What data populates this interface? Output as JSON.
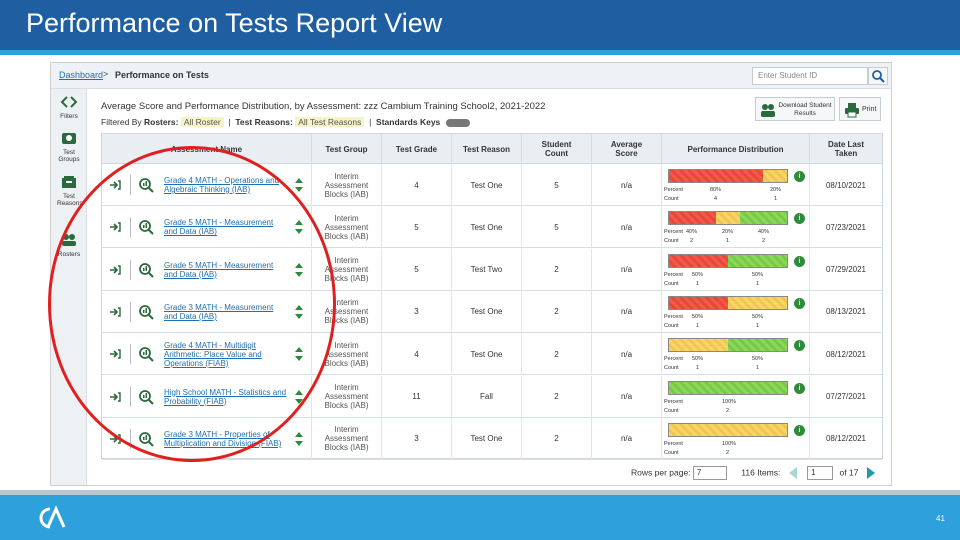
{
  "slide": {
    "title": "Performance on Tests Report View",
    "number": "41"
  },
  "nav": {
    "breadcrumb_link": "Dashboard",
    "breadcrumb_sep": ">",
    "breadcrumb_current": "Performance on Tests",
    "search_placeholder": "Enter Student ID"
  },
  "sidebar": [
    {
      "label": "Filters",
      "icon": "filters-icon"
    },
    {
      "label": "Test Groups",
      "icon": "test-groups-icon"
    },
    {
      "label": "Test Reasons",
      "icon": "test-reasons-icon"
    },
    {
      "label": "Rosters",
      "icon": "rosters-icon"
    }
  ],
  "report": {
    "title": "Average Score and Performance Distribution, by Assessment: zzz Cambium Training School2, 2021-2022",
    "filtered_by": "Filtered By",
    "rosters_label": "Rosters:",
    "rosters_value": "All Roster",
    "reasons_label": "Test Reasons:",
    "reasons_value": "All Test Reasons",
    "standards_label": "Standards Keys",
    "download_label": "Download Student Results",
    "print_label": "Print"
  },
  "columns": [
    "Assessment Name",
    "Test Group",
    "Test Grade",
    "Test Reason",
    "Student Count",
    "Average Score",
    "Performance Distribution",
    "Date Last Taken"
  ],
  "rows": [
    {
      "name": "Grade 4 MATH - Operations and Algebraic Thinking (IAB)",
      "group": "Interim Assessment Blocks (IAB)",
      "grade": "4",
      "reason": "Test One",
      "count": "5",
      "avg": "n/a",
      "date": "08/10/2021",
      "segments": [
        {
          "color": "red",
          "pct": 80
        },
        {
          "color": "yellow",
          "pct": 20
        }
      ],
      "labels": [
        {
          "pct": "80%",
          "n": "4"
        },
        {
          "pct": "20%",
          "n": "1"
        }
      ]
    },
    {
      "name": "Grade 5 MATH - Measurement and Data (IAB)",
      "group": "Interim Assessment Blocks (IAB)",
      "grade": "5",
      "reason": "Test One",
      "count": "5",
      "avg": "n/a",
      "date": "07/23/2021",
      "segments": [
        {
          "color": "red",
          "pct": 40
        },
        {
          "color": "yellow",
          "pct": 20
        },
        {
          "color": "green",
          "pct": 40
        }
      ],
      "labels": [
        {
          "pct": "40%",
          "n": "2"
        },
        {
          "pct": "20%",
          "n": "1"
        },
        {
          "pct": "40%",
          "n": "2"
        }
      ]
    },
    {
      "name": "Grade 5 MATH - Measurement and Data (IAB)",
      "group": "Interim Assessment Blocks (IAB)",
      "grade": "5",
      "reason": "Test Two",
      "count": "2",
      "avg": "n/a",
      "date": "07/29/2021",
      "segments": [
        {
          "color": "red",
          "pct": 50
        },
        {
          "color": "green",
          "pct": 50
        }
      ],
      "labels": [
        {
          "pct": "50%",
          "n": "1"
        },
        {
          "pct": "50%",
          "n": "1"
        }
      ]
    },
    {
      "name": "Grade 3 MATH - Measurement and Data (IAB)",
      "group": "Interim Assessment Blocks (IAB)",
      "grade": "3",
      "reason": "Test One",
      "count": "2",
      "avg": "n/a",
      "date": "08/13/2021",
      "segments": [
        {
          "color": "red",
          "pct": 50
        },
        {
          "color": "yellow",
          "pct": 50
        }
      ],
      "labels": [
        {
          "pct": "50%",
          "n": "1"
        },
        {
          "pct": "50%",
          "n": "1"
        }
      ]
    },
    {
      "name": "Grade 4 MATH - Multidigit Arithmetic: Place Value and Operations (FIAB)",
      "group": "Interim Assessment Blocks (IAB)",
      "grade": "4",
      "reason": "Test One",
      "count": "2",
      "avg": "n/a",
      "date": "08/12/2021",
      "segments": [
        {
          "color": "yellow",
          "pct": 50
        },
        {
          "color": "green",
          "pct": 50
        }
      ],
      "labels": [
        {
          "pct": "50%",
          "n": "1"
        },
        {
          "pct": "50%",
          "n": "1"
        }
      ]
    },
    {
      "name": "High School MATH - Statistics and Probability (FIAB)",
      "group": "Interim Assessment Blocks (IAB)",
      "grade": "11",
      "reason": "Fall",
      "count": "2",
      "avg": "n/a",
      "date": "07/27/2021",
      "segments": [
        {
          "color": "green",
          "pct": 100
        }
      ],
      "labels": [
        {
          "pct": "100%",
          "n": "2"
        }
      ]
    },
    {
      "name": "Grade 3 MATH - Properties of Multiplication and Division (FIAB)",
      "group": "Interim Assessment Blocks (IAB)",
      "grade": "3",
      "reason": "Test One",
      "count": "2",
      "avg": "n/a",
      "date": "08/12/2021",
      "segments": [
        {
          "color": "yellow",
          "pct": 100
        }
      ],
      "labels": [
        {
          "pct": "100%",
          "n": "2"
        }
      ]
    }
  ],
  "pd_row_labels": {
    "percent": "Percent",
    "count": "Count"
  },
  "pager": {
    "rows_label": "Rows per page:",
    "rows_value": "7",
    "items": "116 Items:",
    "page_value": "1",
    "of_pages": "of 17"
  },
  "colors": {
    "title_bg": "#1f5fa1",
    "accent": "#2ea0dc",
    "red": "#e8463a",
    "yellow": "#f2c64e",
    "green": "#76c946",
    "annotation": "#e02020"
  }
}
